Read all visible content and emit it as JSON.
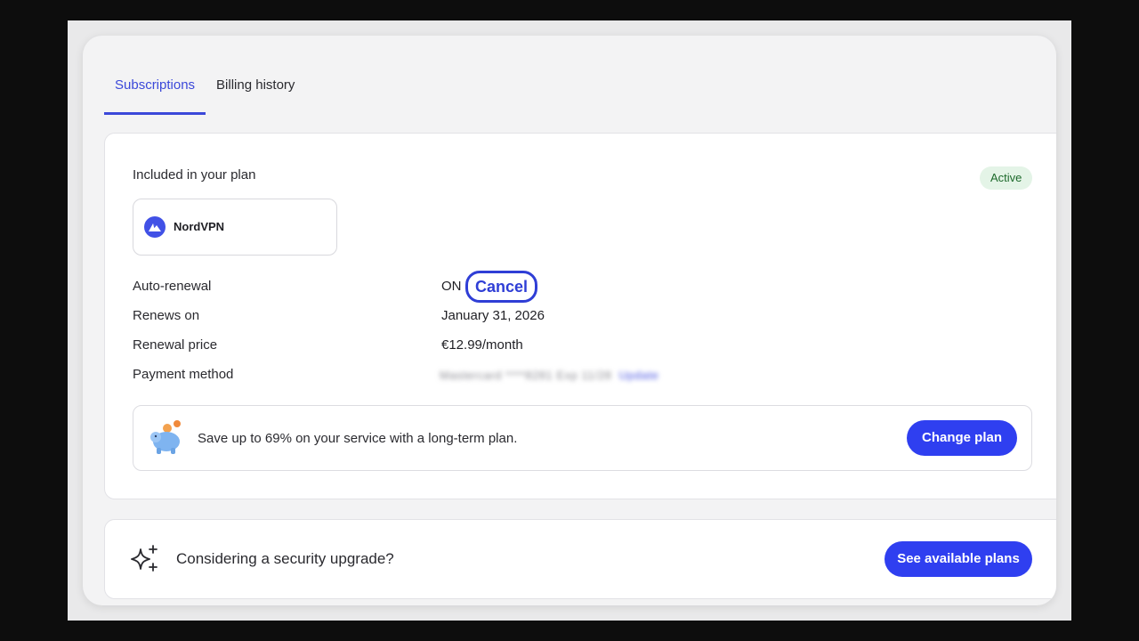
{
  "tabs": [
    {
      "label": "Subscriptions",
      "active": true
    },
    {
      "label": "Billing history",
      "active": false
    }
  ],
  "plan": {
    "included_title": "Included in your plan",
    "status_badge": "Active",
    "product_name": "NordVPN",
    "product_icon": "nordvpn-logo-icon"
  },
  "details": {
    "auto_renewal_label": "Auto-renewal",
    "auto_renewal_value": "ON",
    "cancel_label": "Cancel",
    "renews_on_label": "Renews on",
    "renews_on_value": "January 31, 2026",
    "renewal_price_label": "Renewal price",
    "renewal_price_value": "€12.99/month",
    "payment_method_label": "Payment method",
    "payment_method_value": "Mastercard ****8281 Exp 11/28",
    "payment_update_link": "Update"
  },
  "promo": {
    "icon": "piggy-bank-icon",
    "text": "Save up to 69% on your service with a long-term plan.",
    "button_label": "Change plan"
  },
  "upgrade": {
    "icon": "sparkles-icon",
    "text": "Considering a security upgrade?",
    "button_label": "See available plans"
  },
  "colors": {
    "accent": "#2f3ff0",
    "active_tab": "#3b48d9",
    "badge_bg": "#e4f4e7",
    "badge_text": "#1d6a2b"
  }
}
